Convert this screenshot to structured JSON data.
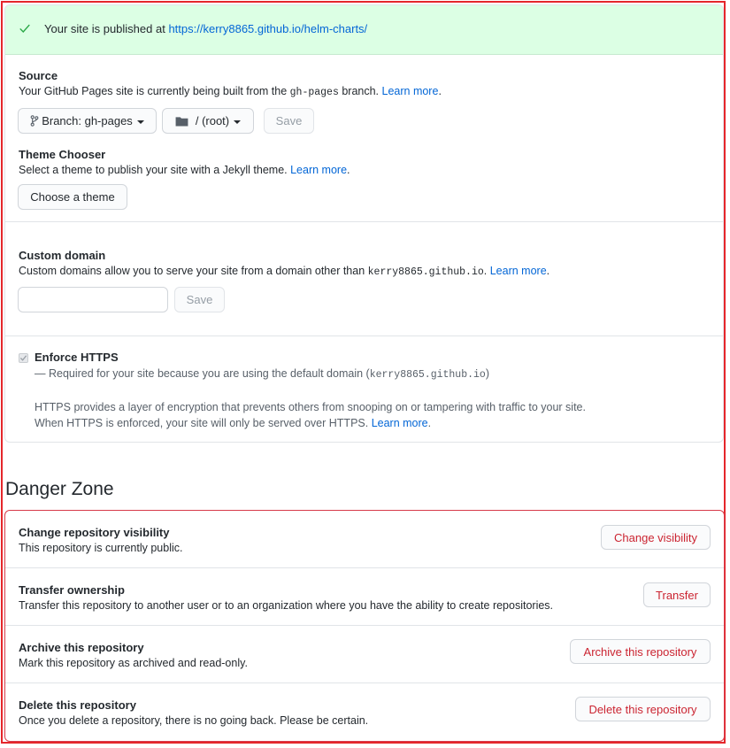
{
  "flash": {
    "prefix": "Your site is published at ",
    "url": "https://kerry8865.github.io/helm-charts/"
  },
  "source": {
    "label": "Source",
    "desc_prefix": "Your GitHub Pages site is currently being built from the ",
    "branch_code": "gh-pages",
    "desc_suffix": " branch. ",
    "learn_more": "Learn more",
    "period": ".",
    "branch_button": "Branch: gh-pages",
    "folder_button": "/ (root)",
    "save_button": "Save"
  },
  "theme": {
    "label": "Theme Chooser",
    "desc": "Select a theme to publish your site with a Jekyll theme. ",
    "learn_more": "Learn more",
    "period": ".",
    "choose_button": "Choose a theme"
  },
  "custom_domain": {
    "label": "Custom domain",
    "desc_prefix": "Custom domains allow you to serve your site from a domain other than ",
    "domain_code": "kerry8865.github.io",
    "desc_suffix": ". ",
    "learn_more": "Learn more",
    "period": ".",
    "input_value": "",
    "save_button": "Save"
  },
  "https": {
    "label": "Enforce HTTPS",
    "required_prefix": "— Required for your site because you are using the default domain (",
    "required_code": "kerry8865.github.io",
    "required_suffix": ")",
    "info_line1": "HTTPS provides a layer of encryption that prevents others from snooping on or tampering with traffic to your site.",
    "info_line2": "When HTTPS is enforced, your site will only be served over HTTPS. ",
    "learn_more": "Learn more",
    "period": ".",
    "checked": true
  },
  "danger_zone": {
    "title": "Danger Zone",
    "rows": [
      {
        "title": "Change repository visibility",
        "desc": "This repository is currently public.",
        "button": "Change visibility"
      },
      {
        "title": "Transfer ownership",
        "desc": "Transfer this repository to another user or to an organization where you have the ability to create repositories.",
        "button": "Transfer"
      },
      {
        "title": "Archive this repository",
        "desc": "Mark this repository as archived and read-only.",
        "button": "Archive this repository"
      },
      {
        "title": "Delete this repository",
        "desc": "Once you delete a repository, there is no going back. Please be certain.",
        "button": "Delete this repository"
      }
    ]
  },
  "colors": {
    "success_bg": "#dcffe4",
    "link": "#0366d6",
    "danger": "#cb2431",
    "highlight_frame": "#e5262b"
  },
  "icons": {
    "flash": "check-icon",
    "branch": "git-branch-icon",
    "folder": "folder-icon"
  }
}
